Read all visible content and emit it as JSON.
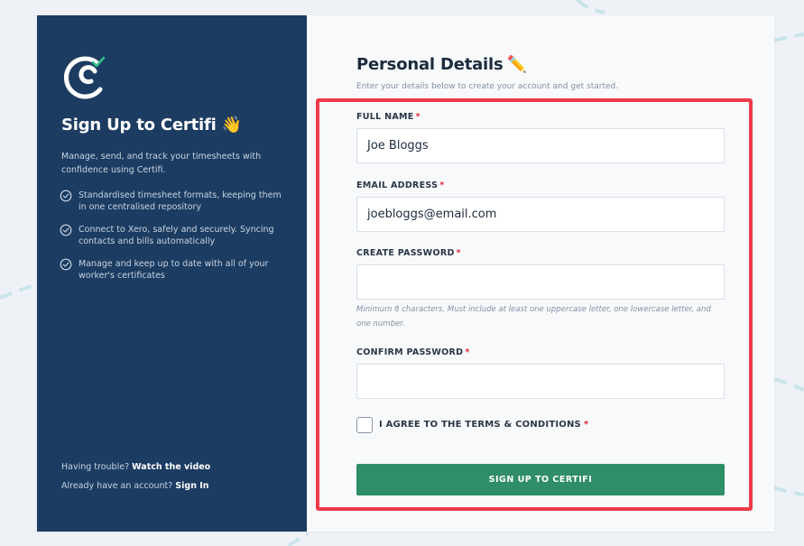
{
  "sidebar": {
    "title": "Sign Up to Certifi 👋",
    "description": "Manage, send, and track your timesheets with confidence using Certifi.",
    "features": [
      {
        "text": "Standardised timesheet formats, keeping them in one centralised repository"
      },
      {
        "text": "Connect to Xero, safely and securely. Syncing contacts and bills automatically"
      },
      {
        "text": "Manage and keep up to date with all of your worker's certificates"
      }
    ],
    "trouble_text": "Having trouble?",
    "trouble_link": "Watch the video",
    "account_text": "Already have an account?",
    "account_link": "Sign In"
  },
  "form": {
    "title": "Personal Details",
    "title_emoji": "✏️",
    "subtitle": "Enter your details below to create your account and get started.",
    "required_marker": "*",
    "full_name": {
      "label": "FULL NAME",
      "value": "Joe Bloggs"
    },
    "email": {
      "label": "EMAIL ADDRESS",
      "value": "joebloggs@email.com"
    },
    "password": {
      "label": "CREATE PASSWORD",
      "value": ""
    },
    "password_hint": "Minimum 8 characters. Must include at least one uppercase letter, one lowercase letter, and one number.",
    "confirm_password": {
      "label": "CONFIRM PASSWORD",
      "value": ""
    },
    "terms_label": "I AGREE TO THE TERMS & CONDITIONS",
    "terms_checked": false,
    "submit_label": "SIGN UP TO CERTIFI"
  },
  "colors": {
    "sidebar_bg": "#1c3c62",
    "button_green": "#2f8d68",
    "highlight_red": "#f03a4a",
    "required_red": "#e0283c",
    "logo_check_green": "#33c08a"
  },
  "icons": {
    "logo": "certifi-logo-icon",
    "feature": "check-circle-icon",
    "pencil": "pencil-icon"
  }
}
